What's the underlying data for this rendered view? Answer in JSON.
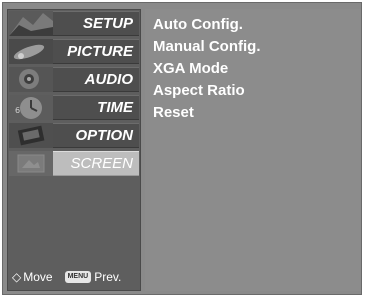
{
  "menu": {
    "items": [
      {
        "label": "SETUP",
        "icon": "setup-thumbnail-icon",
        "selected": false
      },
      {
        "label": "PICTURE",
        "icon": "picture-thumbnail-icon",
        "selected": false
      },
      {
        "label": "AUDIO",
        "icon": "audio-thumbnail-icon",
        "selected": false
      },
      {
        "label": "TIME",
        "icon": "time-thumbnail-icon",
        "selected": false
      },
      {
        "label": "OPTION",
        "icon": "option-thumbnail-icon",
        "selected": false
      },
      {
        "label": "SCREEN",
        "icon": "screen-thumbnail-icon",
        "selected": true
      }
    ]
  },
  "submenu": {
    "items": [
      "Auto Config.",
      "Manual Config.",
      "XGA Mode",
      "Aspect Ratio",
      "Reset"
    ]
  },
  "hint": {
    "move_icon": "dpad-arrows-icon",
    "move_label": "Move",
    "menu_key": "MENU",
    "prev_label": "Prev."
  },
  "colors": {
    "panel_bg": "#8a8a8a",
    "menu_label_bg": "#4e4e4e",
    "selected_bg": "#bdbdbd",
    "text": "#ffffff"
  }
}
